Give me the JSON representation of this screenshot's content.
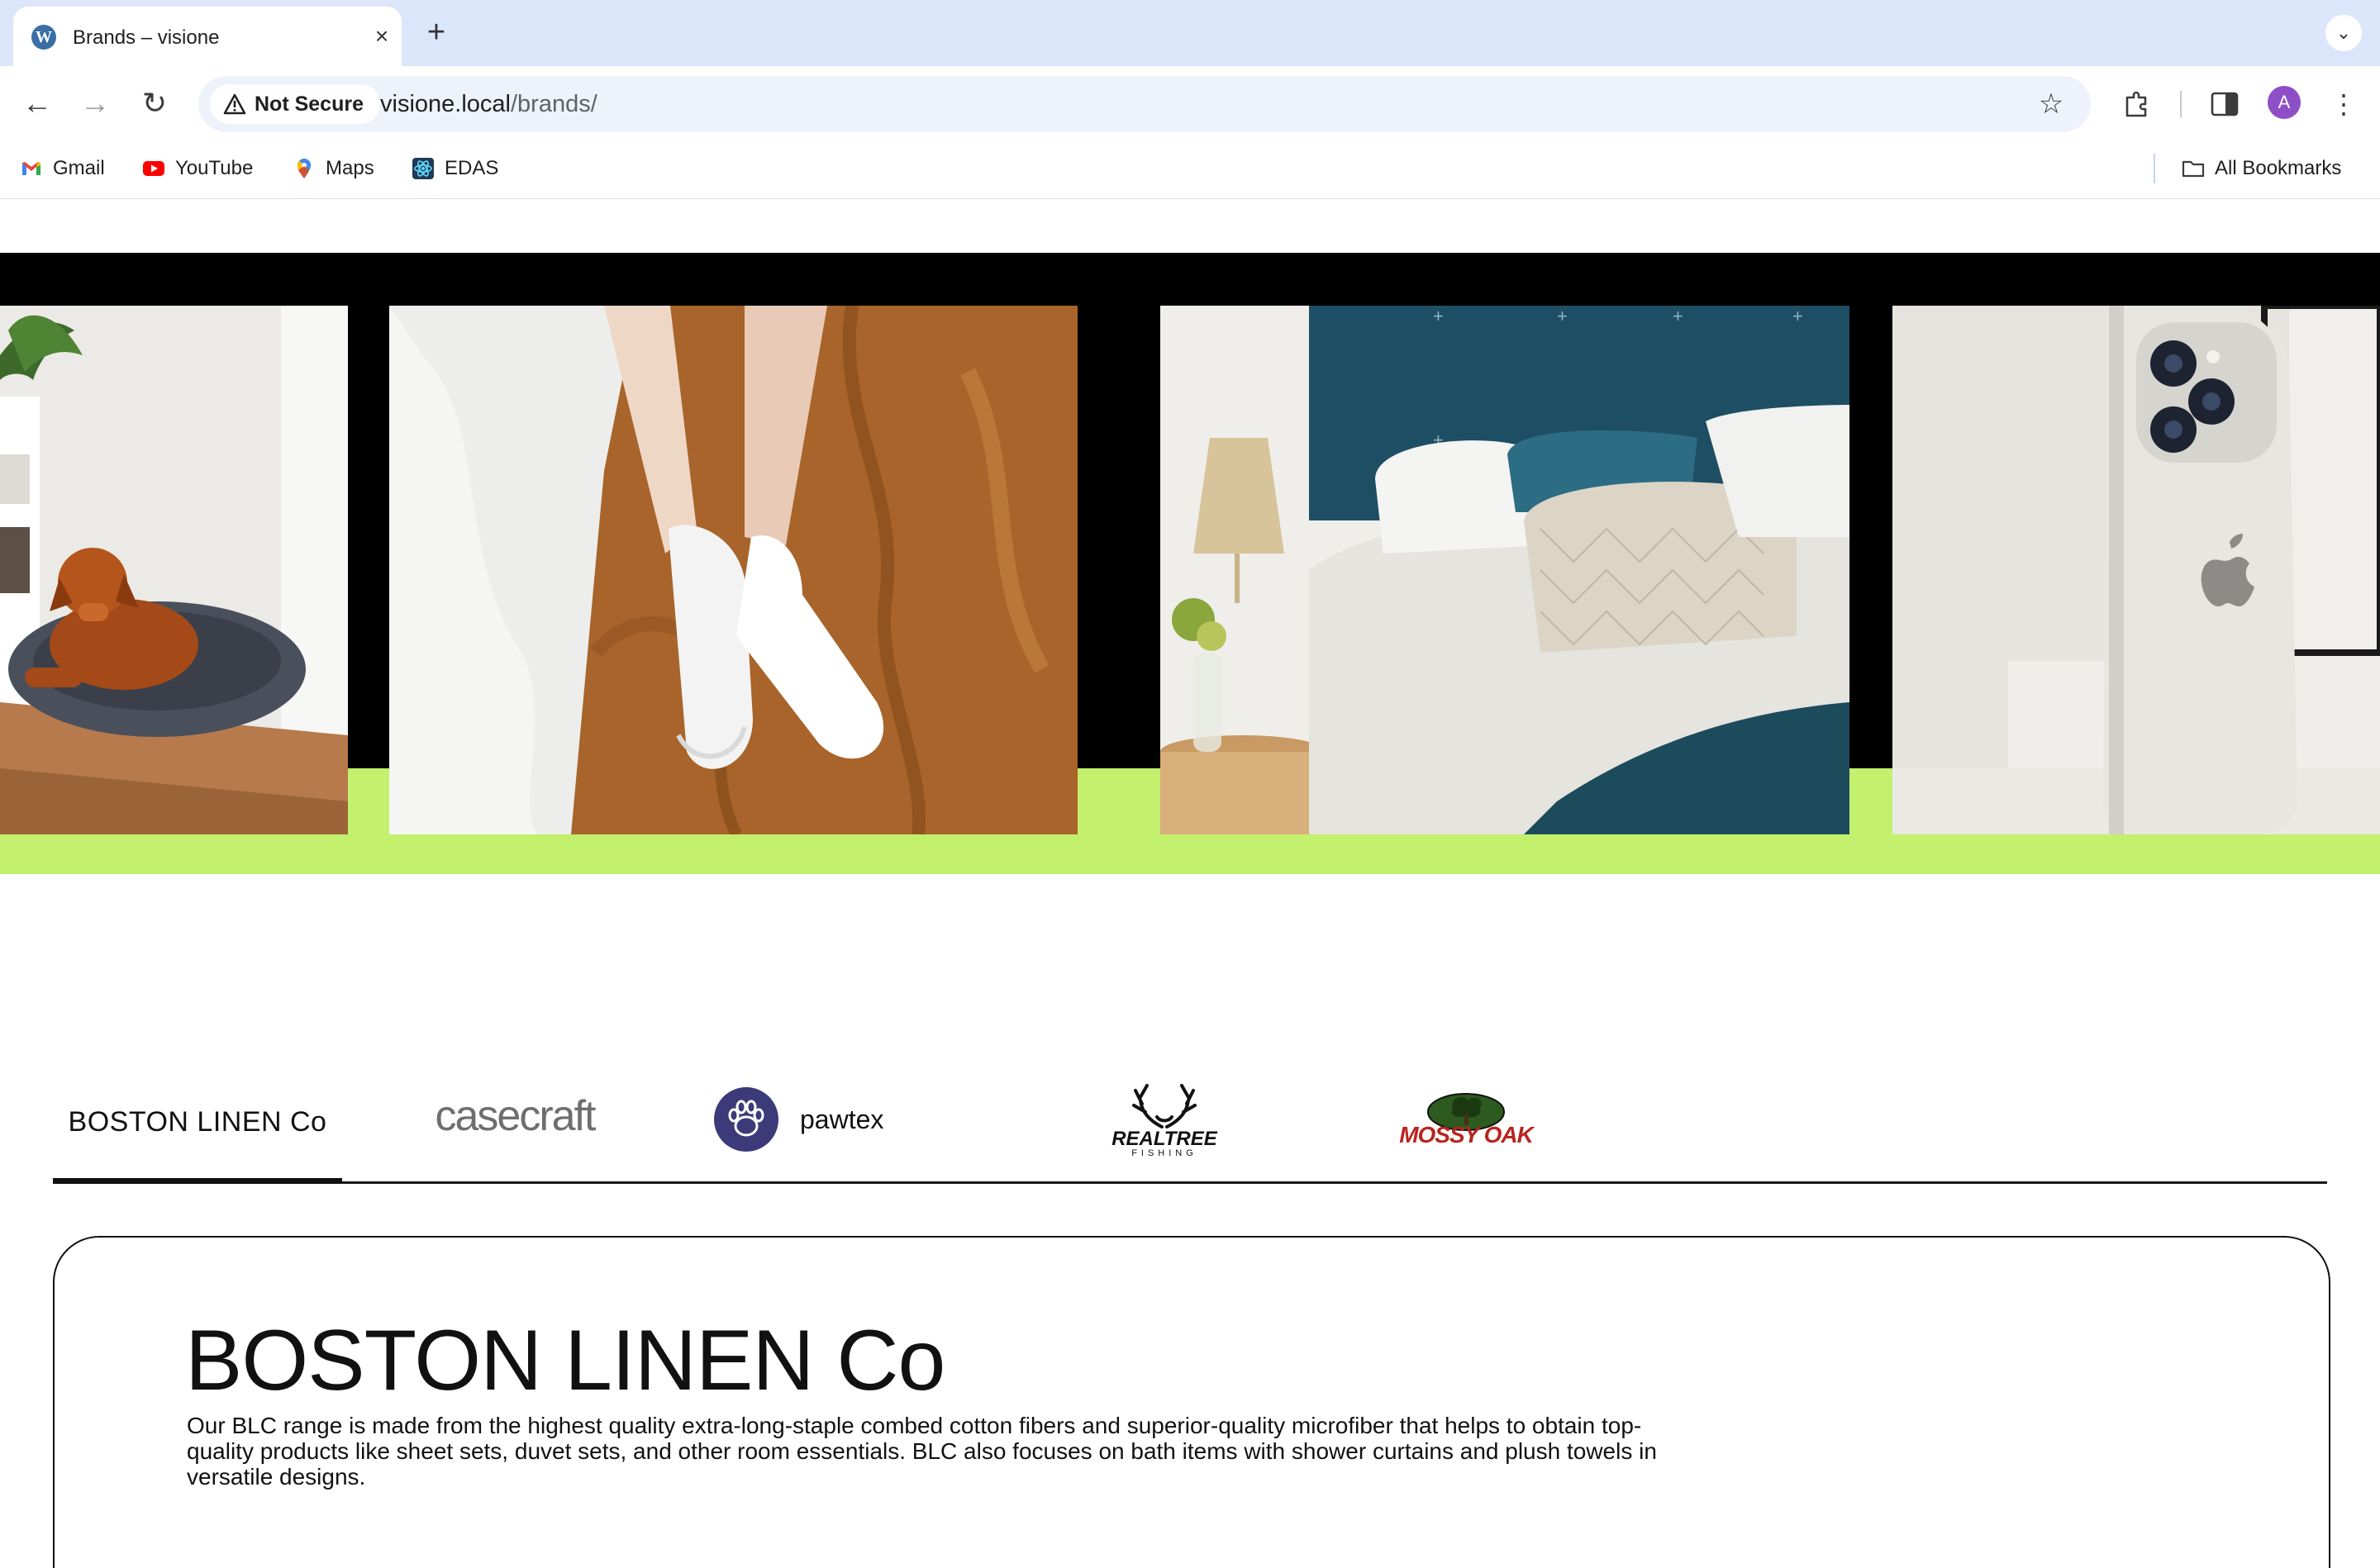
{
  "browser": {
    "tab_title": "Brands – visione",
    "security_label": "Not Secure",
    "url_host": "visione.local",
    "url_path": "/brands/",
    "avatar_letter": "A",
    "bookmarks": [
      {
        "label": "Gmail",
        "icon": "gmail-icon"
      },
      {
        "label": "YouTube",
        "icon": "youtube-icon"
      },
      {
        "label": "Maps",
        "icon": "maps-icon"
      },
      {
        "label": "EDAS",
        "icon": "edas-icon"
      }
    ],
    "all_bookmarks_label": "All Bookmarks"
  },
  "hero": {
    "photos": [
      "dog-on-pet-bed",
      "socks-on-linen",
      "bed-with-pillows",
      "phone-case"
    ],
    "colors": {
      "band": "#000000",
      "accent": "#c3f06d"
    }
  },
  "brands": {
    "tabs": [
      {
        "label": "BOSTON LINEN Co",
        "active": true
      },
      {
        "label": "casecraft",
        "active": false
      },
      {
        "label": "pawtex",
        "active": false
      },
      {
        "label": "REALTREE",
        "sub": "FISHING",
        "active": false
      },
      {
        "label": "MOSSY OAK",
        "active": false
      }
    ],
    "selected": {
      "title": "BOSTON LINEN Co",
      "description": "Our BLC range is made from the highest quality extra-long-staple combed cotton fibers and superior-quality microfiber that helps to obtain top-quality products like sheet sets, duvet sets, and other room essentials. BLC also focuses on bath items with shower curtains and plush towels in versatile designs."
    }
  }
}
